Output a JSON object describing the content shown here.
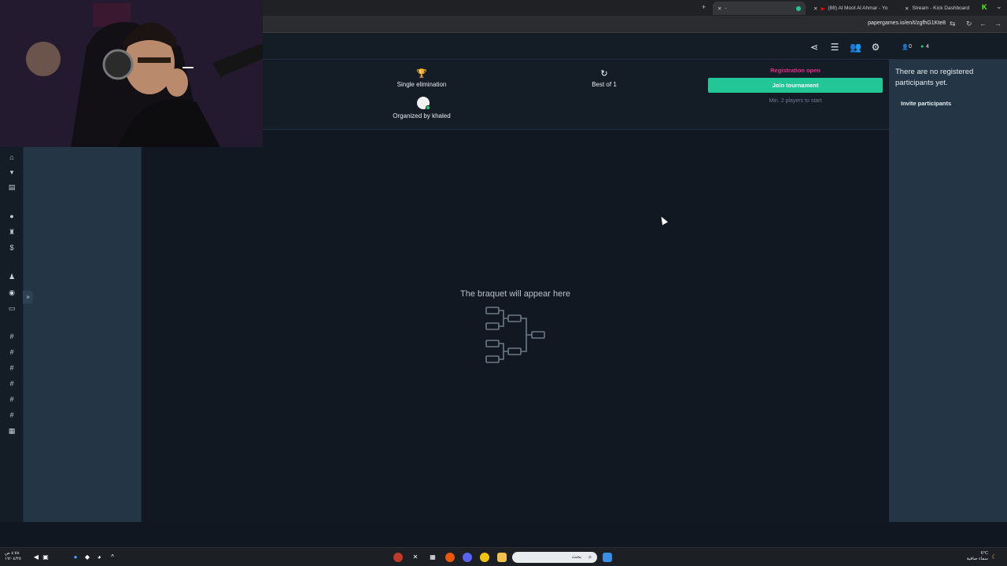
{
  "browser": {
    "tabs": [
      {
        "label": "-",
        "icon": "generic-tab-icon"
      },
      {
        "label": "(88) Al Moot Al Ahmar - Yo",
        "icon": "youtube-icon",
        "icon_color": "#ff0000"
      },
      {
        "label": "Stream - Kick Dashboard",
        "icon": "kick-icon",
        "icon_color": "#53fc18"
      }
    ],
    "url": "papergames.io/en/t/zgfhG1Kte8"
  },
  "tournament": {
    "format": "Single elimination",
    "best_of": "Best of 1",
    "organizer": "Organized by khaled",
    "registration_status": "Registration open",
    "join_label": "Join tournament",
    "min_players": "Min. 2 players to start"
  },
  "bracket": {
    "placeholder": "The braquet will appear here"
  },
  "participants": {
    "count_registered": "0",
    "count_online": "4",
    "empty_message": "There are no registered participants yet.",
    "invite_label": "Invite participants"
  },
  "taskbar": {
    "search_placeholder": "بحث",
    "time": "٤:٥٨ ص",
    "date": "١٧/٠٤/٢٥",
    "weather_temp": "6°C",
    "weather_desc": "سماء صافية"
  },
  "colors": {
    "accent_green": "#22c795",
    "registration_pink": "#e02e8a",
    "panel_bg": "#243545",
    "main_bg": "#111821"
  }
}
